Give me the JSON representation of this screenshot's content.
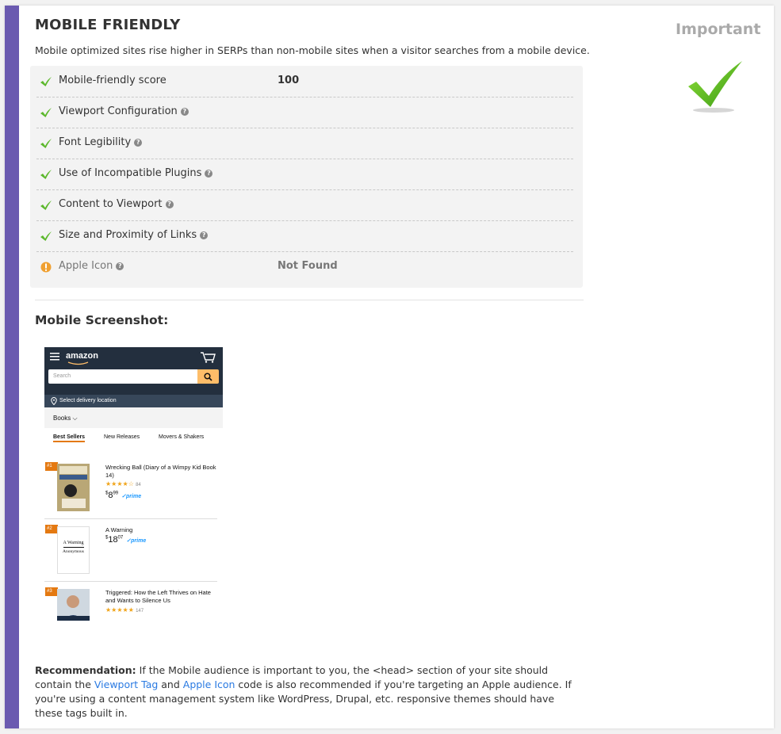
{
  "colors": {
    "accent": "#6a5ab0",
    "check_green": "#5cb82c",
    "warn_orange": "#f0a030",
    "link": "#2a7ae2"
  },
  "section": {
    "title": "MOBILE FRIENDLY",
    "description": "Mobile optimized sites rise higher in SERPs than non-mobile sites when a visitor searches from a mobile device.",
    "importance": "Important"
  },
  "checks": [
    {
      "label": "Mobile-friendly score",
      "value": "100",
      "status": "pass",
      "help": false
    },
    {
      "label": "Viewport Configuration",
      "value": "",
      "status": "pass",
      "help": true
    },
    {
      "label": "Font Legibility",
      "value": "",
      "status": "pass",
      "help": true
    },
    {
      "label": "Use of Incompatible Plugins",
      "value": "",
      "status": "pass",
      "help": true
    },
    {
      "label": "Content to Viewport",
      "value": "",
      "status": "pass",
      "help": true
    },
    {
      "label": "Size and Proximity of Links",
      "value": "",
      "status": "pass",
      "help": true
    },
    {
      "label": "Apple Icon",
      "value": "Not Found",
      "status": "warn",
      "help": true
    }
  ],
  "screenshot": {
    "title": "Mobile Screenshot:",
    "logo": "amazon",
    "search_placeholder": "Search",
    "delivery": "Select delivery location",
    "category": "Books ⌵",
    "tabs": [
      "Best Sellers",
      "New Releases",
      "Movers & Shakers"
    ],
    "items": [
      {
        "rank": "#1",
        "name": "Wrecking Ball (Diary of a Wimpy Kid Book 14)",
        "stars": "★★★★☆",
        "reviews": "84",
        "price_dollars": "8",
        "price_cents": "99",
        "prime": "✓prime"
      },
      {
        "rank": "#2",
        "name": "A Warning",
        "price_dollars": "18",
        "price_cents": "07",
        "prime": "✓prime",
        "cover_title": "A Warning",
        "cover_author": "Anonymous"
      },
      {
        "rank": "#3",
        "name": "Triggered: How the Left Thrives on Hate and Wants to Silence Us",
        "stars": "★★★★★",
        "reviews": "147"
      }
    ]
  },
  "recommendation": {
    "label": "Recommendation:",
    "text1": " If the Mobile audience is important to you, the <head> section of your site should contain the ",
    "link1": "Viewport Tag",
    "text2": " and ",
    "link2": "Apple Icon",
    "text3": " code is also recommended if you're targeting an Apple audience. If you're using a content management system like WordPress, Drupal, etc. responsive themes should have these tags built in."
  },
  "icons": {
    "pass": "check-icon",
    "warn": "warning-icon",
    "help": "help-icon"
  }
}
